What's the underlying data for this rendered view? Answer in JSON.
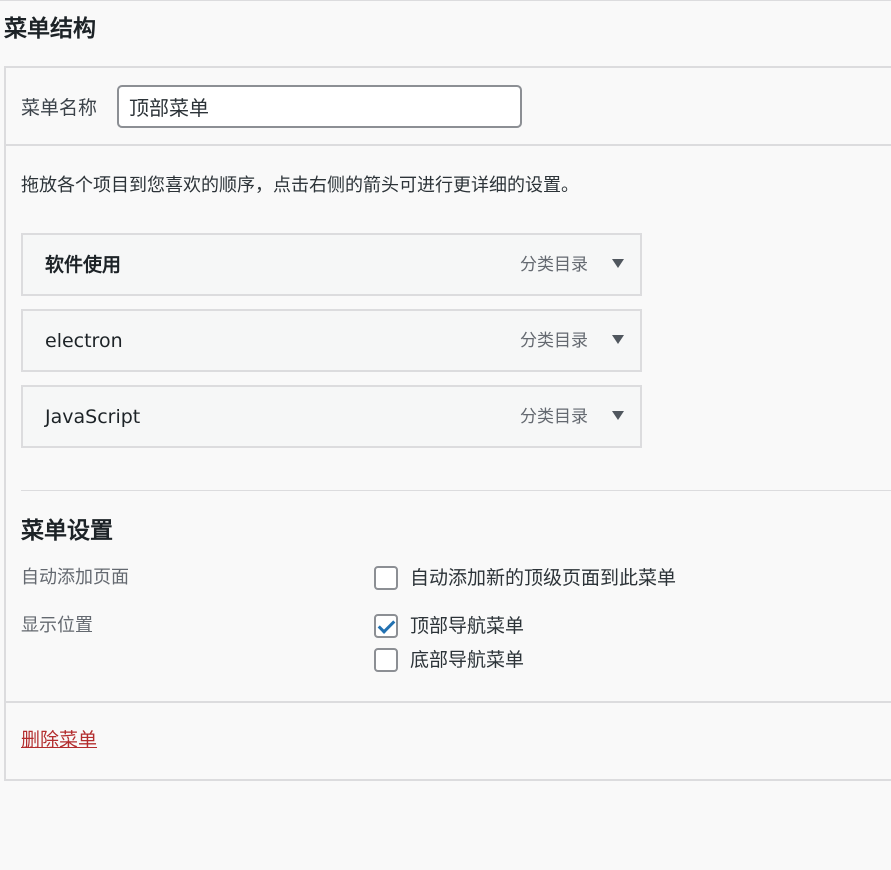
{
  "page": {
    "title": "菜单结构"
  },
  "menu_name": {
    "label": "菜单名称",
    "value": "顶部菜单"
  },
  "instructions": "拖放各个项目到您喜欢的顺序，点击右侧的箭头可进行更详细的设置。",
  "menu_items": [
    {
      "title": "软件使用",
      "type": "分类目录",
      "toggle_icon": "triangle-down-icon"
    },
    {
      "title": "electron",
      "type": "分类目录",
      "toggle_icon": "triangle-down-icon"
    },
    {
      "title": "JavaScript",
      "type": "分类目录",
      "toggle_icon": "triangle-down-icon"
    }
  ],
  "settings": {
    "title": "菜单设置",
    "auto_add": {
      "label": "自动添加页面",
      "option": {
        "label": "自动添加新的顶级页面到此菜单",
        "checked": false
      }
    },
    "display_location": {
      "label": "显示位置",
      "options": [
        {
          "label": "顶部导航菜单",
          "checked": true
        },
        {
          "label": "底部导航菜单",
          "checked": false
        }
      ]
    }
  },
  "footer": {
    "delete_label": "删除菜单"
  },
  "colors": {
    "accent": "#2271b1",
    "delete_link": "#b32d2e",
    "border": "#dcdcde",
    "background": "#f9f9f9"
  }
}
